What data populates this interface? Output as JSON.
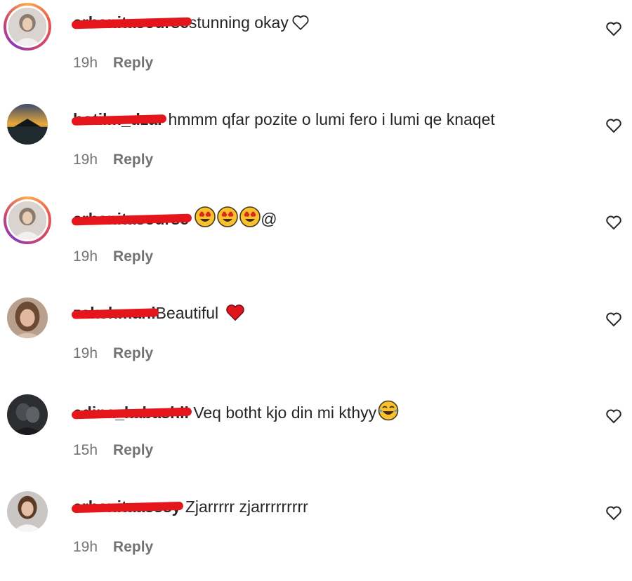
{
  "comments": [
    {
      "username": "arbenitasourse",
      "text": "stunning okay",
      "time": "19h",
      "reply": "Reply",
      "avatar": "avatar-woman-light-icon",
      "ring": true,
      "trail": "heart-outline-icon"
    },
    {
      "username": "botilm_dzar",
      "text": "hmmm qfar pozite o lumi fero i lumi qe knaqet",
      "time": "19h",
      "reply": "Reply",
      "avatar": "avatar-sunset-icon",
      "ring": false,
      "trail": ""
    },
    {
      "username": "arbenitasourse",
      "text": "",
      "time": "19h",
      "reply": "Reply",
      "avatar": "avatar-woman-light-icon",
      "ring": true,
      "trail": "heart-eyes-emoji-x3",
      "suffix": "@"
    },
    {
      "username": "zekshmani",
      "text": "Beautiful",
      "time": "19h",
      "reply": "Reply",
      "avatar": "avatar-woman-brown-icon",
      "ring": false,
      "trail": "red-heart-emoji"
    },
    {
      "username": "edina_kabashii",
      "text": "Veq botht kjo din mi kthyy",
      "time": "15h",
      "reply": "Reply",
      "avatar": "avatar-dark-couple-icon",
      "ring": false,
      "trail": "tears-of-joy-emoji"
    },
    {
      "username": "arbenitaasssy",
      "text": "Zjarrrrr zjarrrrrrrrr",
      "time": "19h",
      "reply": "Reply",
      "avatar": "avatar-woman-white-top-icon",
      "ring": false,
      "trail": ""
    }
  ],
  "colors": {
    "redaction": "#e4161b",
    "muted": "#737373",
    "text": "#262626"
  }
}
